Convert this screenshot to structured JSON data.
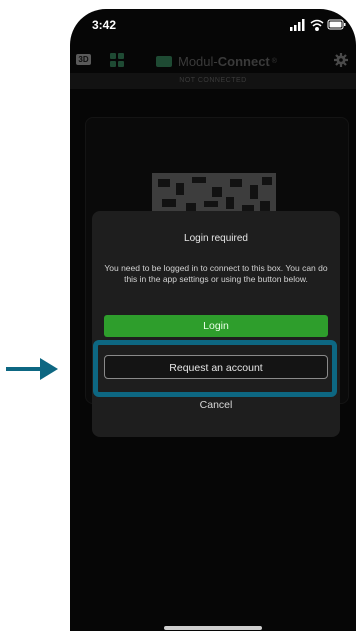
{
  "status_bar": {
    "time": "3:42"
  },
  "app_bar": {
    "badge_3d": "3D",
    "brand_prefix": "Modul-",
    "brand_name": "Connect",
    "brand_sup": "®"
  },
  "connection_status": "NOT CONNECTED",
  "dialog": {
    "title": "Login required",
    "message": "You need to be logged in to connect to this box. You can do this in the app settings or using the button below.",
    "login_label": "Login",
    "request_label": "Request an account",
    "cancel_label": "Cancel"
  },
  "colors": {
    "accent_green": "#2e9e2c",
    "highlight": "#0d6782",
    "arrow": "#0d6782"
  }
}
